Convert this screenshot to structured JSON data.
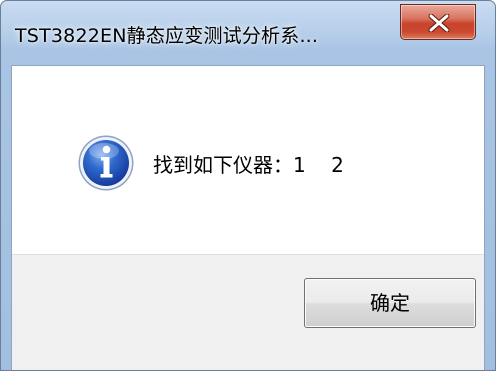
{
  "window": {
    "title": "TST3822EN静态应变测试分析系...",
    "close_icon": "close-icon"
  },
  "message": {
    "icon": "information-icon",
    "text": "找到如下仪器：1    2"
  },
  "buttons": {
    "ok_label": "确定"
  },
  "colors": {
    "close_button": "#c9432c",
    "info_icon": "#1f4fb4",
    "footer_bg": "#f0f0f0"
  }
}
